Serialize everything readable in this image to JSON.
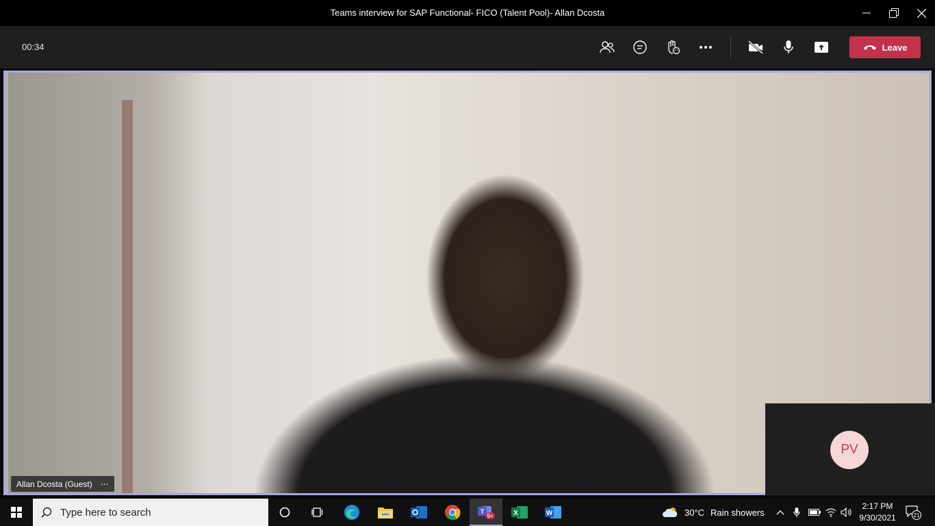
{
  "window": {
    "title": "Teams interview for SAP Functional- FICO (Talent Pool)- Allan Dcosta"
  },
  "toolbar": {
    "timer": "00:34",
    "leave_label": "Leave"
  },
  "participants": {
    "main_name": "Allan Dcosta (Guest)",
    "more_glyph": "⋯",
    "secondary_initials": "PV"
  },
  "taskbar": {
    "search_placeholder": "Type here to search",
    "teams_badge": "9+",
    "weather_temp": "30°C",
    "weather_desc": "Rain showers",
    "time": "2:17 PM",
    "date": "9/30/2021",
    "notification_count": "21"
  },
  "colors": {
    "leave_red": "#c4314b",
    "stage_border": "#a6a7dc",
    "avatar_bg": "#f6d6d9"
  }
}
